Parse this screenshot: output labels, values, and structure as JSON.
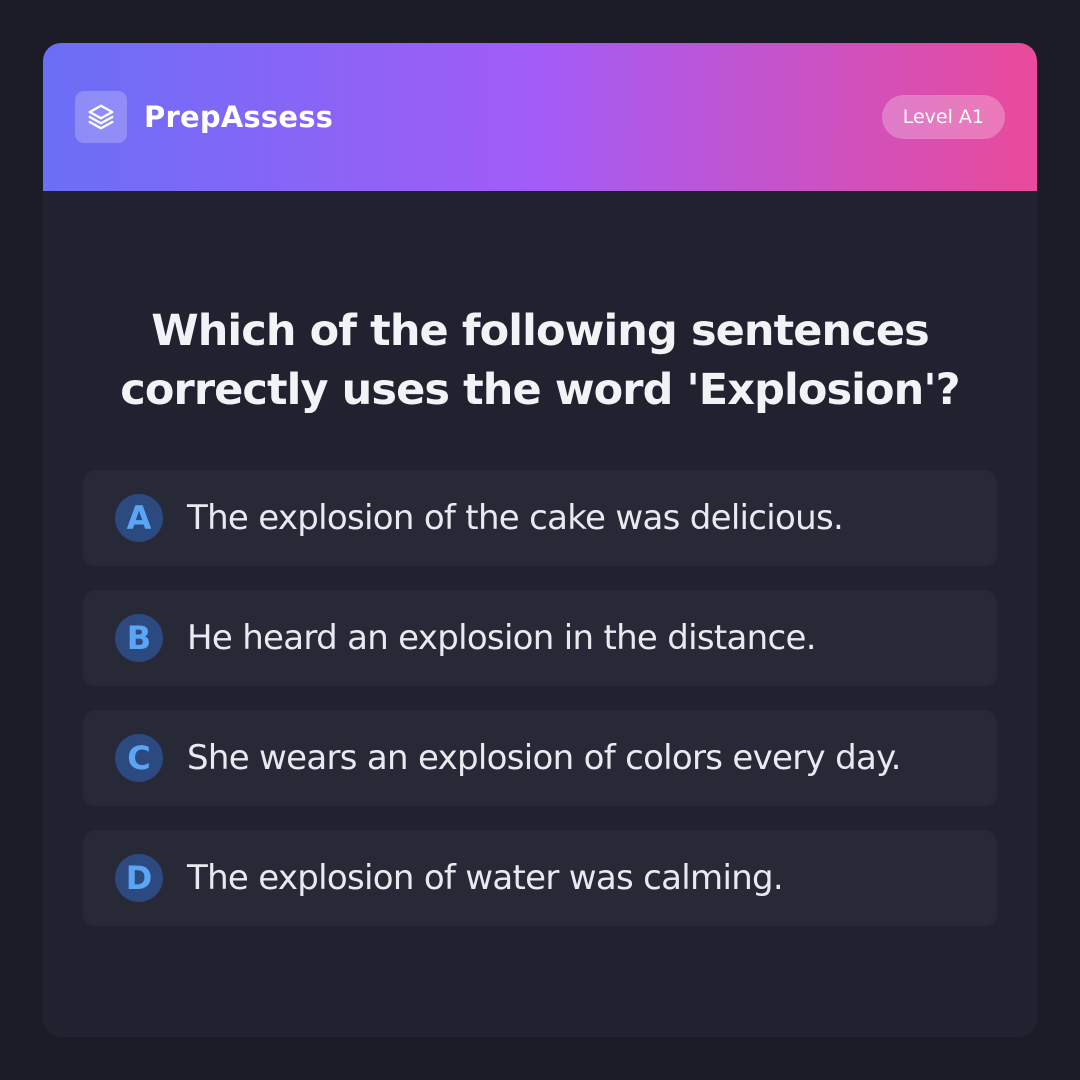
{
  "header": {
    "brand": "PrepAssess",
    "logo_icon": "layers-icon",
    "level_badge": "Level A1",
    "gradient": [
      "#6a6ff5",
      "#a35cf7",
      "#ea4a9a"
    ]
  },
  "question": {
    "text": "Which of the following sentences correctly uses the word 'Explosion'?"
  },
  "options": [
    {
      "letter": "A",
      "text": "The explosion of the cake was delicious."
    },
    {
      "letter": "B",
      "text": "He heard an explosion in the distance."
    },
    {
      "letter": "C",
      "text": "She wears an explosion of colors every day."
    },
    {
      "letter": "D",
      "text": "The explosion of water was calming."
    }
  ],
  "colors": {
    "background": "#1b1c27",
    "card": "#20222f",
    "option_bg": "#272937",
    "letter_bg": "#2c4a80",
    "letter_fg": "#5aa5f4"
  }
}
